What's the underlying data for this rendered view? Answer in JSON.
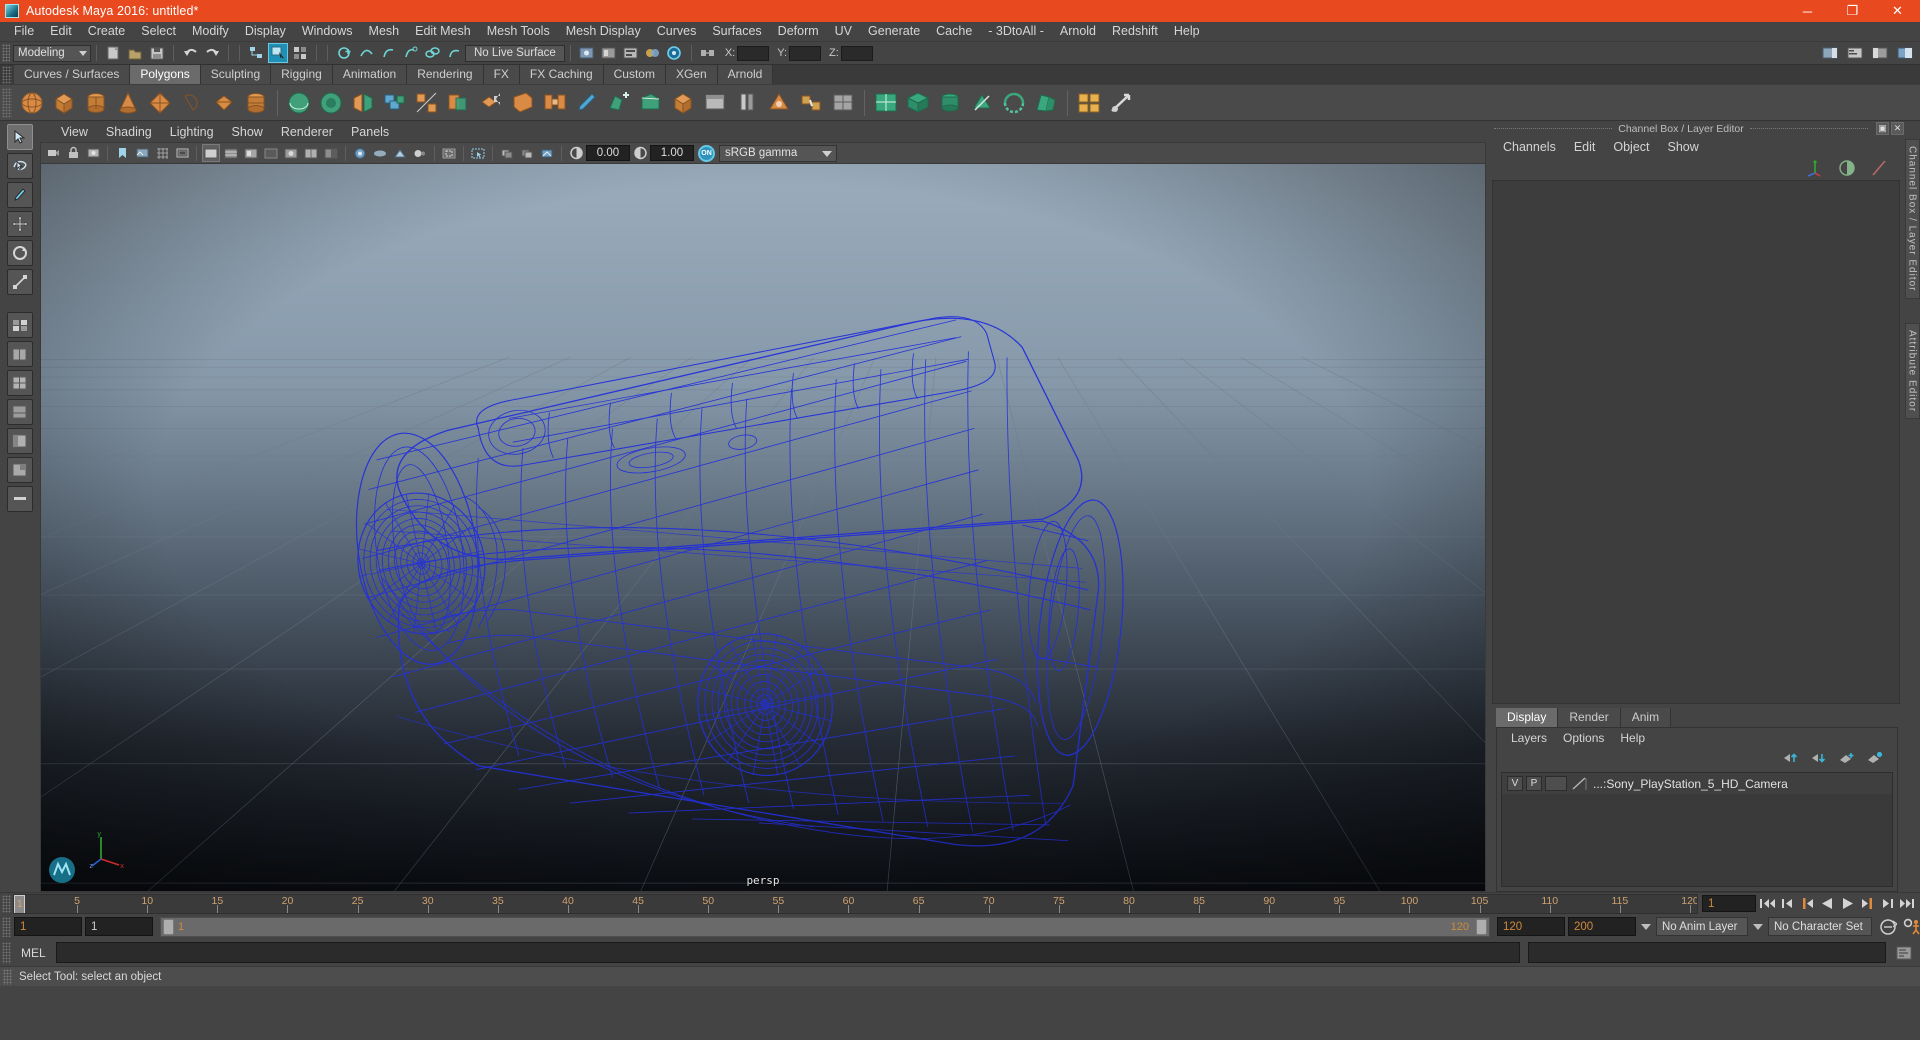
{
  "window": {
    "title": "Autodesk Maya 2016: untitled*",
    "app_icon": "maya-logo-icon",
    "controls": {
      "minimize": "─",
      "maximize": "❐",
      "close": "✕"
    },
    "titlebar_color": "#e8491e"
  },
  "menubar": {
    "items": [
      "File",
      "Edit",
      "Create",
      "Select",
      "Modify",
      "Display",
      "Windows",
      "Mesh",
      "Edit Mesh",
      "Mesh Tools",
      "Mesh Display",
      "Curves",
      "Surfaces",
      "Deform",
      "UV",
      "Generate",
      "Cache",
      "- 3DtoAll -",
      "Arnold",
      "Redshift",
      "Help"
    ]
  },
  "statusline": {
    "menu_set": "Modeling",
    "live_surface": "No Live Surface",
    "coord_labels": [
      "X:",
      "Y:",
      "Z:"
    ],
    "coord_values": [
      "",
      "",
      ""
    ]
  },
  "shelf": {
    "tabs": [
      "Curves / Surfaces",
      "Polygons",
      "Sculpting",
      "Rigging",
      "Animation",
      "Rendering",
      "FX",
      "FX Caching",
      "Custom",
      "XGen",
      "Arnold"
    ],
    "active_tab": "Polygons",
    "icon_names": [
      "poly-sphere",
      "poly-cube",
      "poly-cylinder",
      "poly-cone",
      "poly-torus",
      "poly-plane",
      "poly-disc",
      "poly-pyramid",
      "poly-prism",
      "sphere-smooth",
      "cube-smooth",
      "combine",
      "separate",
      "booleans",
      "mirror",
      "extrude",
      "bevel",
      "bridge",
      "append",
      "wedge",
      "smooth",
      "triangulate",
      "quadrangulate",
      "crease",
      "sculpt-tools",
      "uv-editor",
      "uv-layout",
      "uv-unfold",
      "uv-cut",
      "uv-sew",
      "uv-transfer",
      "uv-snapshot"
    ]
  },
  "toolbox": {
    "tools": [
      "select-tool",
      "lasso-select-tool",
      "paint-select-tool",
      "move-tool",
      "rotate-tool",
      "scale-tool",
      "last-tool-used",
      "show-manipulator-tool",
      "quick-layout-single",
      "quick-layout-four-view",
      "quick-layout-persp-outliner",
      "quick-layout-persp-graph",
      "quick-layout-persp-hypershade",
      "quick-layout-persp-render",
      "quick-layout-more"
    ],
    "selected": "select-tool"
  },
  "viewport": {
    "menus": [
      "View",
      "Shading",
      "Lighting",
      "Show",
      "Renderer",
      "Panels"
    ],
    "camera_label": "persp",
    "toolbar": {
      "exposure_value": "0.00",
      "gamma_value": "1.00",
      "color_management_toggle": "ON",
      "color_profile": "sRGB gamma",
      "icon_names": [
        "select-camera-icon",
        "lock-camera-icon",
        "camera-attributes-icon",
        "bookmarks-icon",
        "image-plane-icon",
        "two-sided-lighting-icon",
        "shadows-icon",
        "ao-icon",
        "motion-blur-icon",
        "multisample-icon",
        "depth-of-field-icon",
        "grid-icon",
        "film-gate-icon",
        "resolution-gate-icon",
        "gate-mask-icon",
        "xray-icon",
        "xray-joints-icon",
        "wireframe-on-shaded-icon",
        "isolate-select-icon",
        "exposure-icon",
        "gamma-icon"
      ]
    },
    "background": {
      "top": "#9aadbe",
      "bottom": "#0d1016"
    },
    "model": {
      "name": "Sony PlayStation 5 HD Camera",
      "wireframe_color": "#2030d8",
      "display_mode": "wireframe"
    },
    "axis_gizmo": {
      "x": "x",
      "y": "y",
      "z": "z"
    }
  },
  "channelbox": {
    "panel_title": "Channel Box / Layer Editor",
    "header_buttons": [
      "undock-icon",
      "close-icon"
    ],
    "menus": [
      "Channels",
      "Edit",
      "Object",
      "Show"
    ],
    "toolbar_icons": [
      "transform-axes-icon",
      "half-circle-icon",
      "diagonal-line-icon"
    ],
    "content": ""
  },
  "layereditor": {
    "tabs": [
      "Display",
      "Render",
      "Anim"
    ],
    "active_tab": "Display",
    "menus": [
      "Layers",
      "Options",
      "Help"
    ],
    "buttons": [
      "move-layer-up-icon",
      "move-layer-down-icon",
      "create-new-layer-icon",
      "create-layer-from-selected-icon"
    ],
    "layers": [
      {
        "visibility": "V",
        "playback": "P",
        "shading": "",
        "color_swatch": "#9a9a9a",
        "name": "...:Sony_PlayStation_5_HD_Camera"
      }
    ]
  },
  "vertical_tabs": [
    "Channel Box / Layer Editor",
    "Attribute Editor"
  ],
  "timeslider": {
    "ticks": [
      5,
      10,
      15,
      20,
      25,
      30,
      35,
      40,
      45,
      50,
      55,
      60,
      65,
      70,
      75,
      80,
      85,
      90,
      95,
      100,
      105,
      110,
      115,
      120
    ],
    "current_frame": "1",
    "range_start": 1,
    "range_end": 120,
    "current_frame_field": "1",
    "playback_buttons": [
      "go-to-start-icon",
      "step-back-frame-icon",
      "step-back-key-icon",
      "play-backwards-icon",
      "play-forwards-icon",
      "step-forward-key-icon",
      "step-forward-frame-icon",
      "go-to-end-icon"
    ]
  },
  "rangeslider": {
    "anim_start": "1",
    "playback_start": "1",
    "playback_end": "120",
    "anim_end": "200",
    "bar_start_label": "1",
    "bar_end_label": "120",
    "anim_layer": "No Anim Layer",
    "character_set": "No Character Set",
    "right_icons": [
      "auto-key-icon",
      "animation-preferences-icon"
    ]
  },
  "commandline": {
    "language_label": "MEL",
    "input_value": "",
    "output_value": "",
    "script_editor_icon": "script-editor-icon"
  },
  "statusbar": {
    "help_text": "Select Tool: select an object"
  }
}
